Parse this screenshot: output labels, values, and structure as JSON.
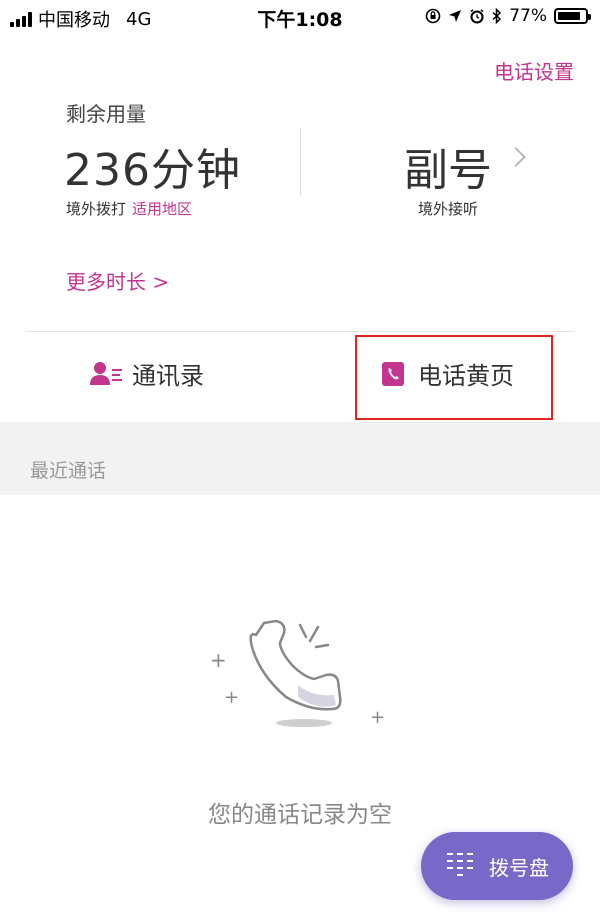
{
  "status_bar": {
    "carrier": "中国移动",
    "network": "4G",
    "time": "下午1:08",
    "battery": "77%",
    "battery_level": 0.77
  },
  "header": {
    "settings_link": "电话设置"
  },
  "usage": {
    "remaining_label": "剩余用量",
    "minutes_value": "236分钟",
    "abroad_call_label": "境外拨打",
    "region_link": "适用地区",
    "sub_number_label": "副号",
    "abroad_answer_label": "境外接听",
    "more_duration_link": "更多时长 >"
  },
  "tabs": {
    "contacts_label": "通讯录",
    "yellowpages_label": "电话黄页"
  },
  "recent": {
    "section_title": "最近通话",
    "empty_message": "您的通话记录为空"
  },
  "fab": {
    "dialpad_label": "拨号盘"
  },
  "colors": {
    "accent": "#c2348f",
    "fab": "#7868c8",
    "highlight": "#e02424"
  },
  "icons": [
    "contacts-icon",
    "phone-book-icon",
    "chevron-right-icon",
    "dialpad-icon",
    "empty-phone-icon",
    "location-arrow-icon",
    "alarm-icon",
    "bluetooth-icon",
    "orientation-lock-icon"
  ]
}
